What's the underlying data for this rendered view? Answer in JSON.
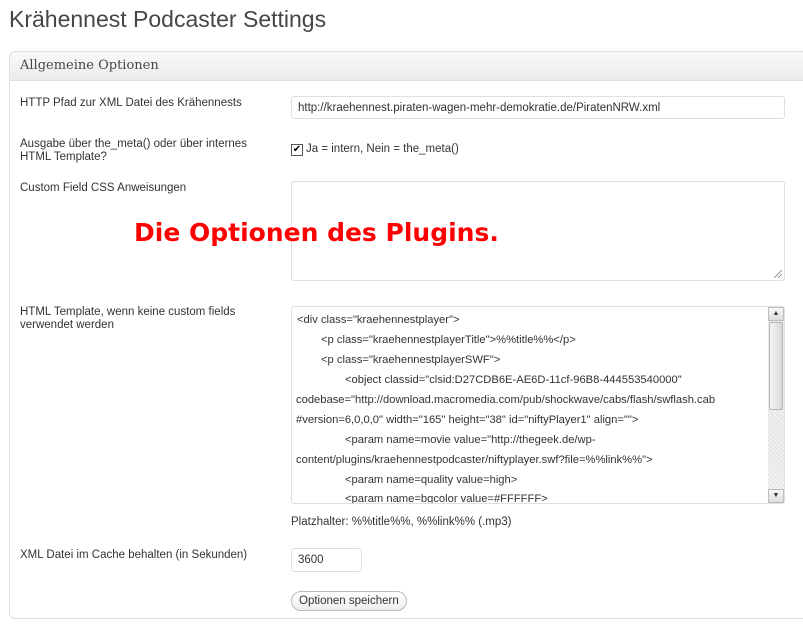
{
  "page": {
    "title": "Krähennest Podcaster Settings"
  },
  "section": {
    "title": "Allgemeine Optionen"
  },
  "fields": {
    "xml_path": {
      "label": "HTTP Pfad zur XML Datei des Krähennests",
      "value": "http://kraehennest.piraten-wagen-mehr-demokratie.de/PiratenNRW.xml"
    },
    "output_mode": {
      "label_line1": "Ausgabe über the_meta() oder über internes",
      "label_line2": "HTML Template?",
      "checkbox_label": "Ja = intern, Nein = the_meta()",
      "checked": true
    },
    "custom_css": {
      "label": "Custom Field CSS Anweisungen",
      "value": ""
    },
    "html_template": {
      "label_line1": "HTML Template, wenn keine custom fields",
      "label_line2": "verwendet werden",
      "lines": [
        "<div class=\"kraehennestplayer\">",
        "<p class=\"kraehennestplayerTitle\">%%title%%</p>",
        "<p class=\"kraehennestplayerSWF\">",
        "<object classid=\"clsid:D27CDB6E-AE6D-11cf-96B8-444553540000\"",
        "codebase=\"http://download.macromedia.com/pub/shockwave/cabs/flash/swflash.cab",
        "#version=6,0,0,0\" width=\"165\" height=\"38\" id=\"niftyPlayer1\" align=\"\">",
        "<param name=movie value=\"http://thegeek.de/wp-",
        "content/plugins/kraehennestpodcaster/niftyplayer.swf?file=%%link%%\">",
        "<param name=quality value=high>",
        "<param name=bgcolor value=#FFFFFF>"
      ],
      "placeholder_hint": "Platzhalter: %%title%%, %%link%% (.mp3)"
    },
    "cache": {
      "label": "XML Datei im Cache behalten (in Sekunden)",
      "value": "3600"
    }
  },
  "save_button": {
    "label": "Optionen speichern"
  },
  "annotation": {
    "text": "Die Optionen des Plugins."
  },
  "colors": {
    "annotation": "#ff0000",
    "border": "#dfdfdf",
    "title": "#464646"
  },
  "icons": {
    "scroll_up": "arrow-up-icon",
    "scroll_down": "arrow-down-icon",
    "check": "check-icon"
  }
}
